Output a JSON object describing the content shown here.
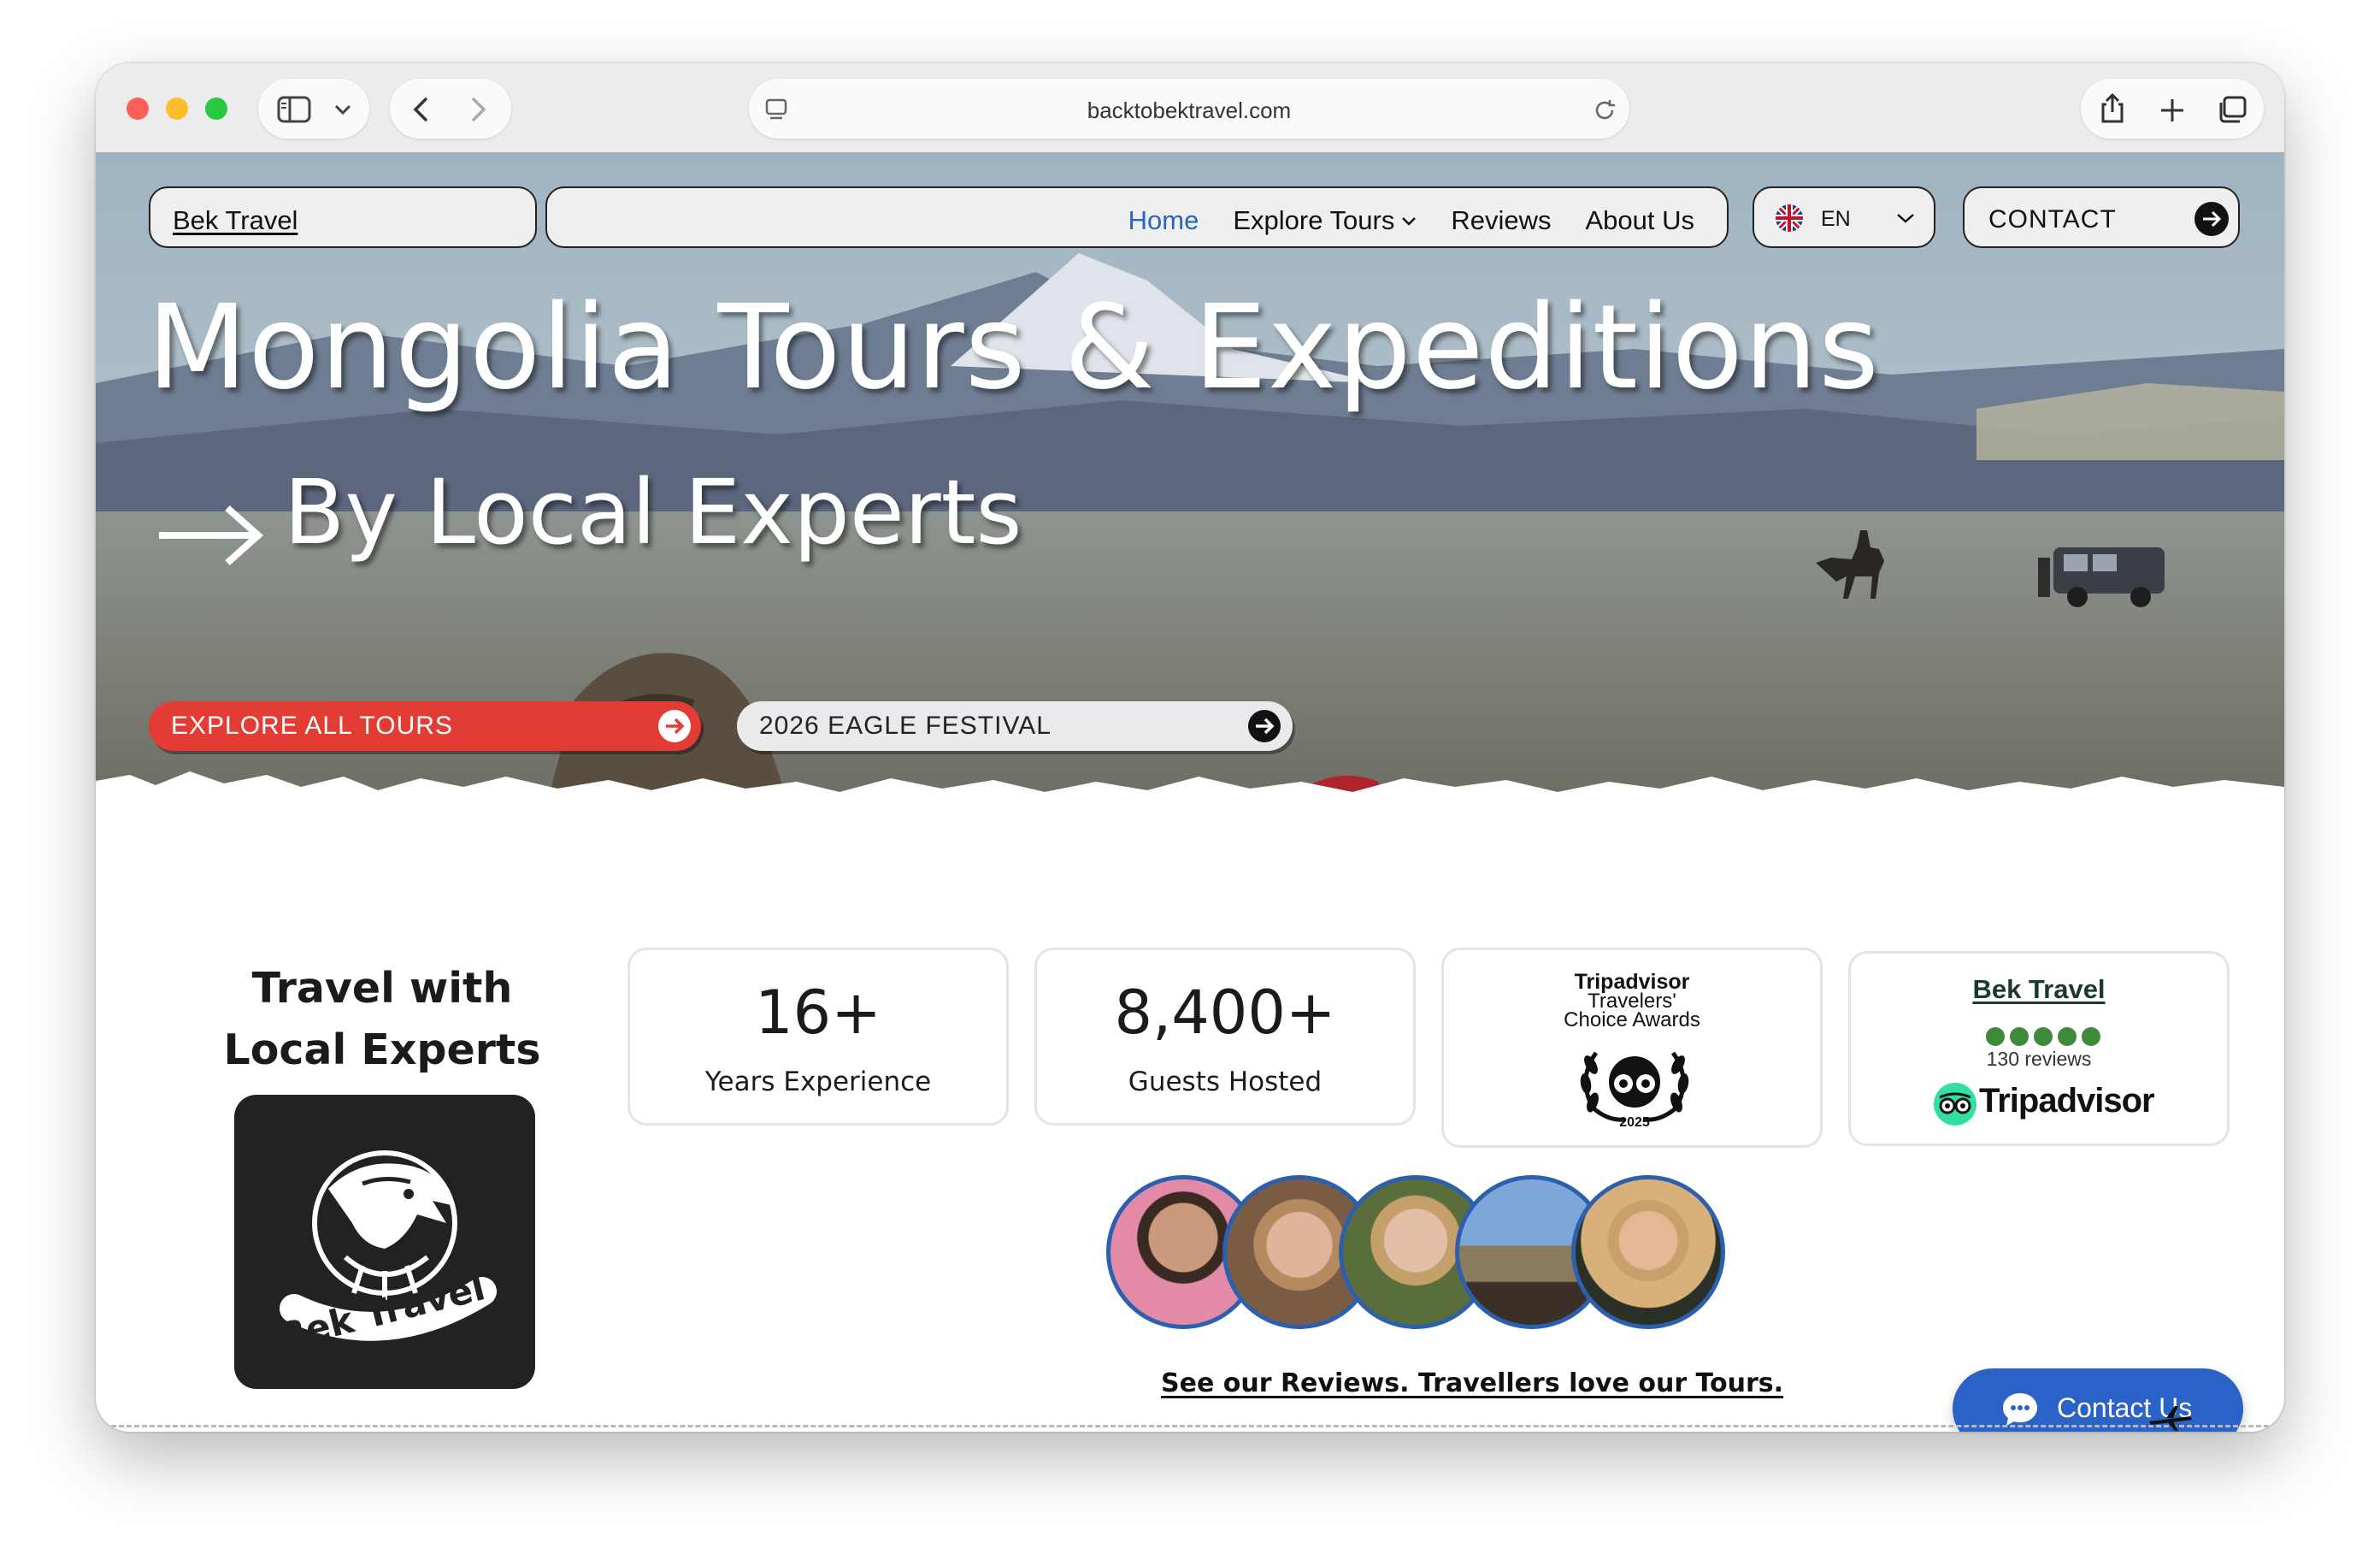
{
  "browser": {
    "url": "backtobektravel.com"
  },
  "header": {
    "brand": "Bek Travel",
    "menu": [
      {
        "label": "Home",
        "active": true
      },
      {
        "label": "Explore Tours",
        "dropdown": true
      },
      {
        "label": "Reviews"
      },
      {
        "label": "About Us"
      }
    ],
    "language": "EN",
    "contact": "CONTACT"
  },
  "hero": {
    "title": "Mongolia Tours & Expeditions",
    "subtitle": "By Local Experts",
    "cta_primary": "EXPLORE ALL TOURS",
    "cta_secondary": "2026 EAGLE FESTIVAL"
  },
  "stats": {
    "title": "Travel with Local Experts",
    "logo_text": "Bek Travel",
    "cards": [
      {
        "value": "16+",
        "label": "Years Experience"
      },
      {
        "value": "8,400+",
        "label": "Guests Hosted"
      }
    ],
    "award": {
      "line1": "Tripadvisor",
      "line2": "Travelers'",
      "line3": "Choice Awards",
      "year": "2025"
    },
    "rating": {
      "brand": "Bek Travel",
      "stars": 5,
      "count": "130 reviews",
      "source": "Tripadvisor"
    }
  },
  "reviews": {
    "link": "See our Reviews. Travellers love our Tours."
  },
  "chat": {
    "label": "Contact Us"
  },
  "colors": {
    "accent_red": "#e23c34",
    "link_blue": "#2a63c2",
    "chat_blue": "#2b62c8",
    "tripadvisor_green": "#3e8a3b"
  }
}
